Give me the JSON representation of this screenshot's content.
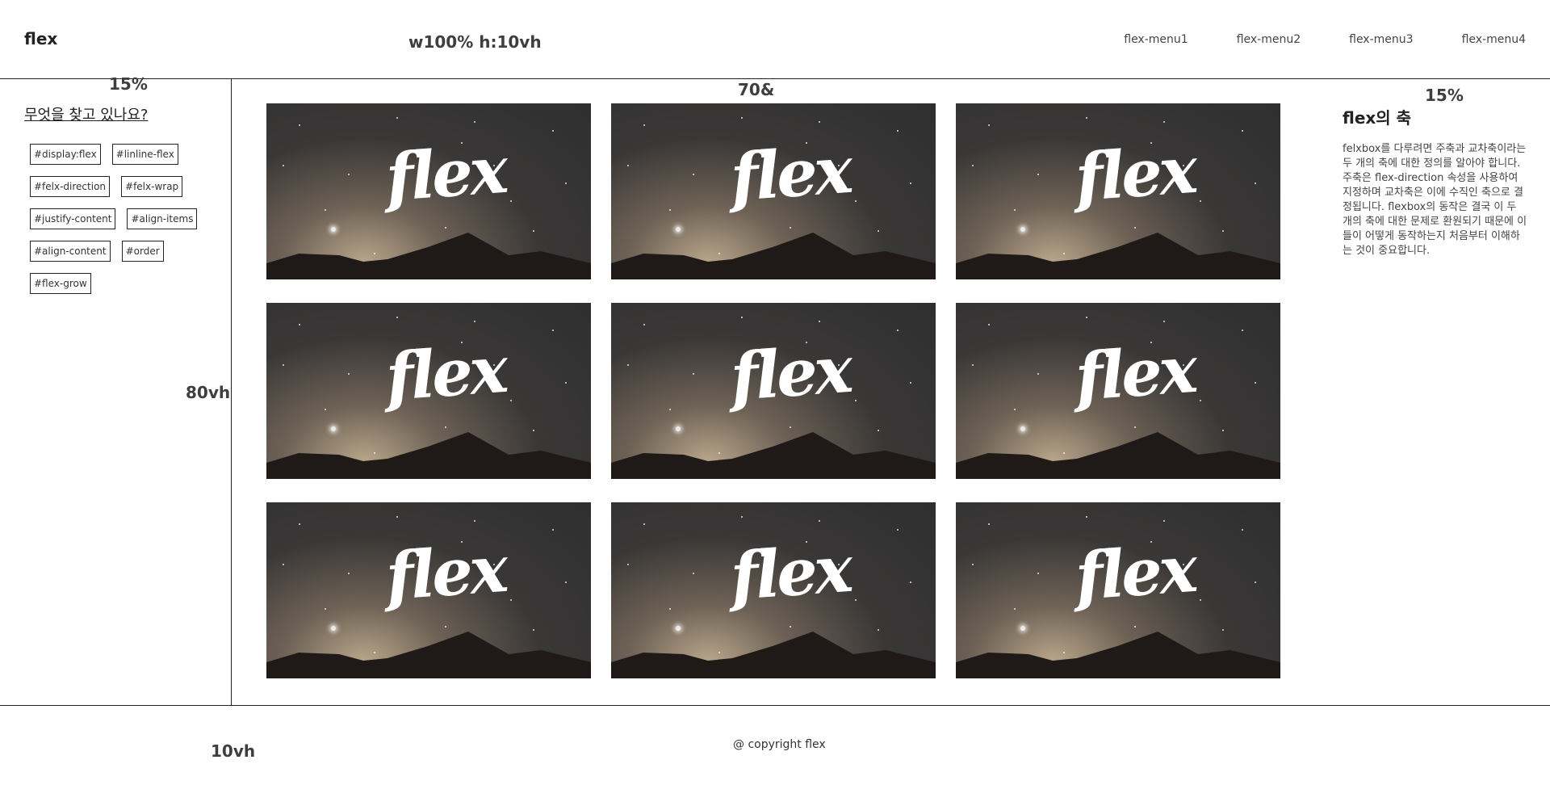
{
  "header": {
    "logo": "flex",
    "size_note": "w100%  h:10vh",
    "menu": [
      "flex-menu1",
      "flex-menu2",
      "flex-menu3",
      "flex-menu4"
    ]
  },
  "left": {
    "width_note": "15%",
    "height_note": "80vh",
    "search_title": "무엇을 찾고 있나요?",
    "tags": [
      "#display:flex",
      "#linline-flex",
      "#felx-direction",
      "#felx-wrap",
      "#justify-content",
      "#align-items",
      "#align-content",
      "#order",
      "#flex-grow"
    ]
  },
  "main": {
    "width_note": "70&",
    "cards": [
      {
        "label": "flex"
      },
      {
        "label": "flex"
      },
      {
        "label": "flex"
      },
      {
        "label": "flex"
      },
      {
        "label": "flex"
      },
      {
        "label": "flex"
      },
      {
        "label": "flex"
      },
      {
        "label": "flex"
      },
      {
        "label": "flex"
      }
    ]
  },
  "right": {
    "width_note": "15%",
    "title": "flex의 축",
    "body": "felxbox를 다루려면 주축과 교차축이라는 두 개의 축에 대한 정의를 알아야 합니다. 주축은 flex-direction 속성을 사용하여 지정하며 교차축은 이에 수직인 축으로 결정됩니다. flexbox의 동작은 결국 이 두 개의 축에 대한 문제로 환원되기 때문에 이들이 어떻게 동작하는지 처음부터 이해하는 것이 중요합니다."
  },
  "footer": {
    "height_note": "10vh",
    "copyright": "@ copyright flex"
  }
}
